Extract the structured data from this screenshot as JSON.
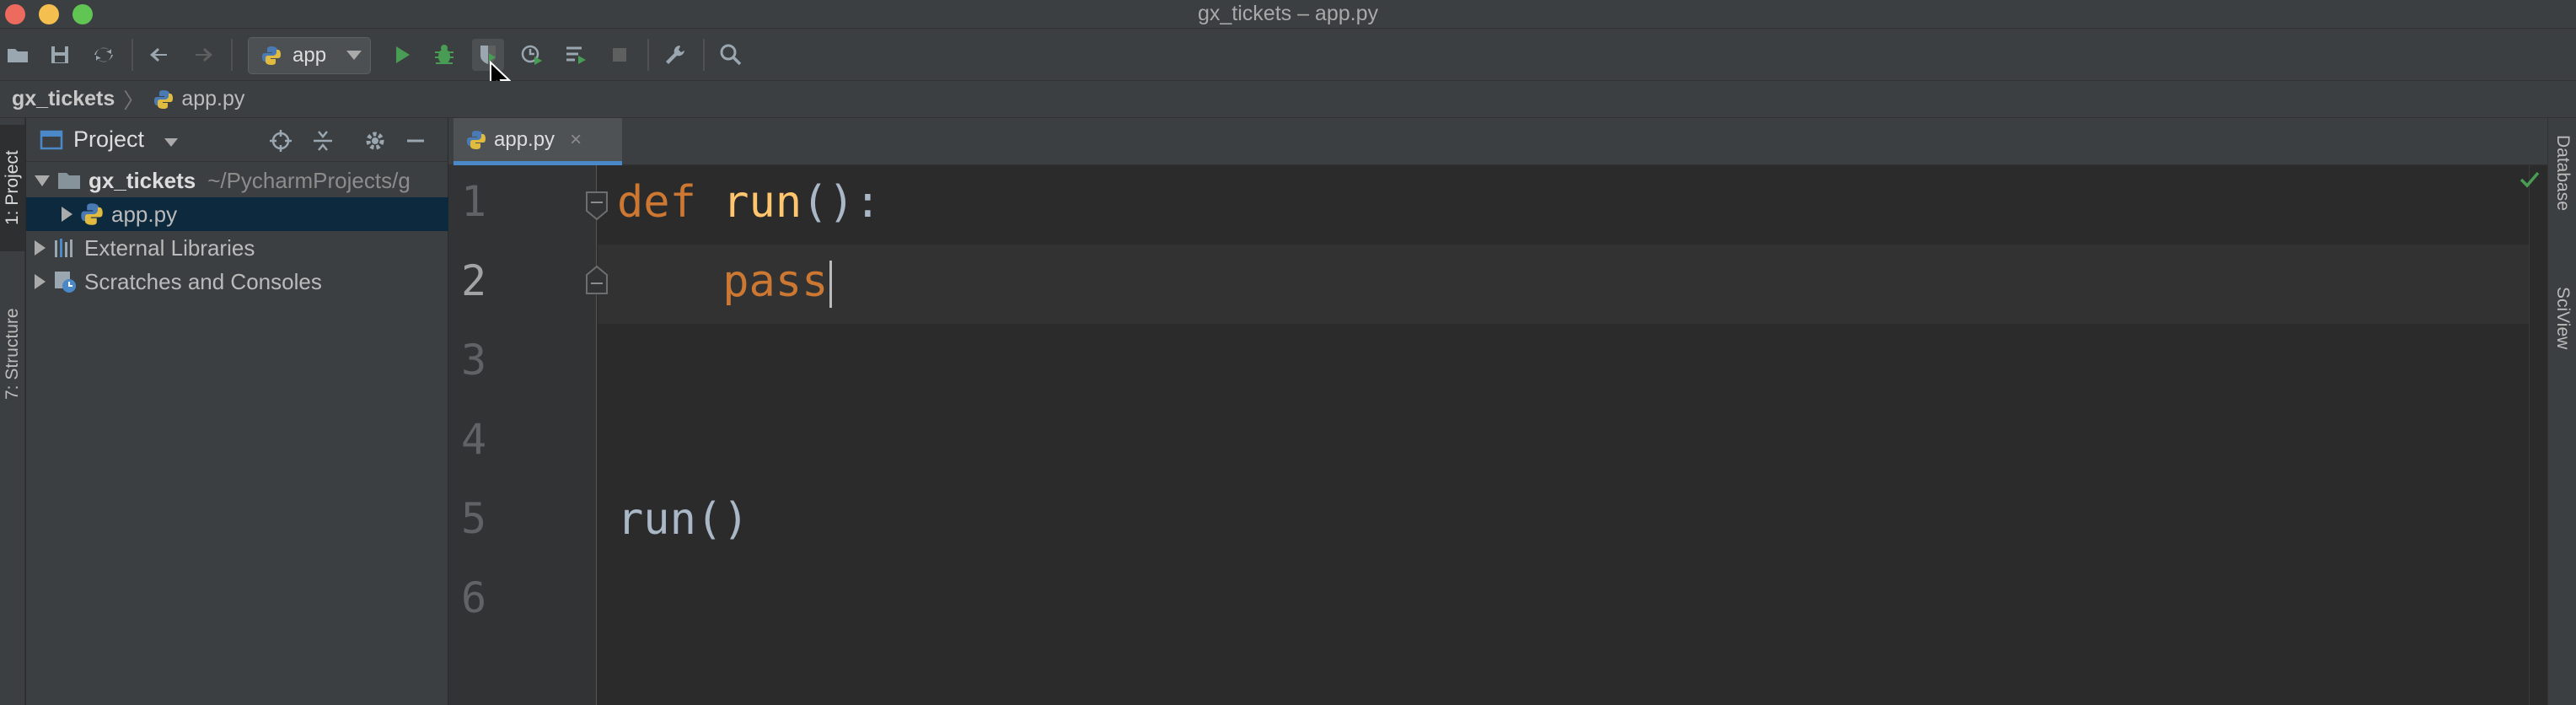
{
  "window": {
    "title": "gx_tickets – app.py"
  },
  "toolbar": {
    "run_config": "app",
    "icons": [
      "open-folder-icon",
      "save-icon",
      "sync-icon",
      "back-icon",
      "forward-icon",
      "python-icon",
      "run-icon",
      "debug-icon",
      "coverage-icon",
      "profile-icon",
      "concurrency-icon",
      "stop-icon",
      "settings-wrench-icon",
      "search-icon"
    ]
  },
  "breadcrumb": {
    "project": "gx_tickets",
    "file": "app.py"
  },
  "left_strip": {
    "project_tab": "1: Project",
    "structure_tab": "7: Structure"
  },
  "right_strip": {
    "database_tab": "Database",
    "sciview_tab": "SciView"
  },
  "project_panel": {
    "title": "Project",
    "tree": [
      {
        "label": "gx_tickets",
        "path": "~/PycharmProjects/g",
        "expanded": true
      },
      {
        "label": "app.py",
        "selected": true
      },
      {
        "label": "External Libraries"
      },
      {
        "label": "Scratches and Consoles"
      }
    ]
  },
  "editor": {
    "tab_label": "app.py",
    "tab_close": "×",
    "line_numbers": [
      "1",
      "2",
      "3",
      "4",
      "5",
      "6"
    ],
    "code": {
      "l1_kw": "def",
      "l1_fn": "run",
      "l1_rest": "():",
      "l2_kw": "pass",
      "l5": "run()"
    }
  },
  "colors": {
    "keyword": "#cc7832",
    "function": "#ffc66d",
    "text": "#a9b7c6",
    "selection": "#0d293e",
    "tab_accent": "#4a88c7"
  }
}
